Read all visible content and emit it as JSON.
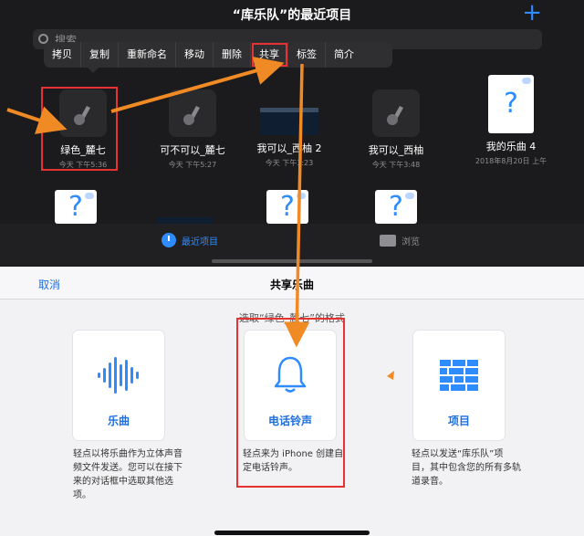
{
  "header": {
    "title": "“库乐队”的最近项目",
    "add_icon": "plus-icon"
  },
  "search": {
    "placeholder": "搜索"
  },
  "context_menu": {
    "items": [
      "拷贝",
      "复制",
      "重新命名",
      "移动",
      "删除",
      "共享",
      "标签",
      "简介"
    ],
    "highlighted": "共享"
  },
  "files": [
    {
      "name": "绿色_麓七",
      "date": "今天 下午5:36",
      "kind": "garageband"
    },
    {
      "name": "可不可以_麓七",
      "date": "今天 下午5:27",
      "kind": "garageband"
    },
    {
      "name": "我可以_西柚 2",
      "date": "今天 下午3:23",
      "kind": "video"
    },
    {
      "name": "我可以_西柚",
      "date": "今天 下午3:48",
      "kind": "garageband"
    },
    {
      "name": "我的乐曲 4",
      "date": "2018年8月20日 上午",
      "kind": "document"
    }
  ],
  "tabs": {
    "recent": "最近项目",
    "browse": "浏览"
  },
  "share_sheet": {
    "cancel": "取消",
    "title": "共享乐曲",
    "prompt": "选取“绿色_麓七”的格式",
    "options": [
      {
        "label": "乐曲",
        "description": "轻点以将乐曲作为立体声音频文件发送。您可以在接下来的对话框中选取其他选项。"
      },
      {
        "label": "电话铃声",
        "description": "轻点来为 iPhone 创建自定电话铃声。"
      },
      {
        "label": "项目",
        "description": "轻点以发送“库乐队”项目，其中包含您的所有多轨道录音。"
      }
    ]
  },
  "colors": {
    "accent": "#2f8cff",
    "annotation_red": "#e63232",
    "annotation_orange": "#f08a24"
  }
}
